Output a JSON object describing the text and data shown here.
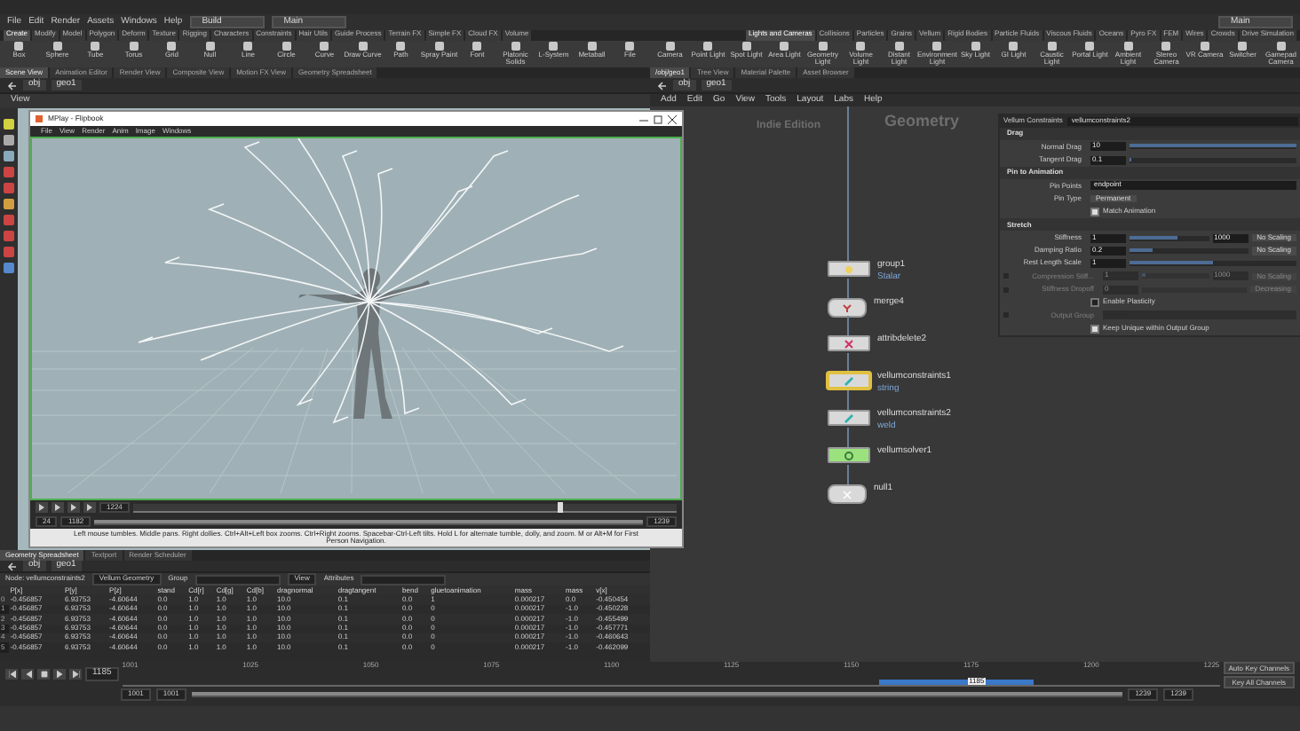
{
  "menu_bar": {
    "items": [
      "File",
      "Edit",
      "Render",
      "Assets",
      "Windows",
      "Help"
    ],
    "build_desktop": "Build",
    "main_desktop": "Main"
  },
  "desktop_menu": "Main",
  "shelf_tabs_left": [
    {
      "label": "Create",
      "selected": true
    },
    {
      "label": "Modify",
      "selected": false
    },
    {
      "label": "Model",
      "selected": false
    },
    {
      "label": "Polygon",
      "selected": false
    },
    {
      "label": "Deform",
      "selected": false
    },
    {
      "label": "Texture",
      "selected": false
    },
    {
      "label": "Rigging",
      "selected": false
    },
    {
      "label": "Characters",
      "selected": false
    },
    {
      "label": "Constraints",
      "selected": false
    },
    {
      "label": "Hair Utils",
      "selected": false
    },
    {
      "label": "Guide Process",
      "selected": false
    },
    {
      "label": "Terrain FX",
      "selected": false
    },
    {
      "label": "Simple FX",
      "selected": false
    },
    {
      "label": "Cloud FX",
      "selected": false
    },
    {
      "label": "Volume",
      "selected": false
    }
  ],
  "shelf_tabs_right": [
    {
      "label": "Lights and Cameras",
      "selected": true
    },
    {
      "label": "Collisions",
      "selected": false
    },
    {
      "label": "Particles",
      "selected": false
    },
    {
      "label": "Grains",
      "selected": false
    },
    {
      "label": "Vellum",
      "selected": false
    },
    {
      "label": "Rigid Bodies",
      "selected": false
    },
    {
      "label": "Particle Fluids",
      "selected": false
    },
    {
      "label": "Viscous Fluids",
      "selected": false
    },
    {
      "label": "Oceans",
      "selected": false
    },
    {
      "label": "Pyro FX",
      "selected": false
    },
    {
      "label": "FEM",
      "selected": false
    },
    {
      "label": "Wires",
      "selected": false
    },
    {
      "label": "Crowds",
      "selected": false
    },
    {
      "label": "Drive Simulation",
      "selected": false
    }
  ],
  "shelf_tools_left": [
    "Box",
    "Sphere",
    "Tube",
    "Torus",
    "Grid",
    "Null",
    "Line",
    "Circle",
    "Curve",
    "Draw Curve",
    "Path",
    "Spray Paint",
    "Font",
    "Platonic Solids",
    "L-System",
    "Metaball",
    "File"
  ],
  "shelf_tools_right": [
    "Camera",
    "Point Light",
    "Spot Light",
    "Area Light",
    "Geometry Light",
    "Volume Light",
    "Distant Light",
    "Environment Light",
    "Sky Light",
    "GI Light",
    "Caustic Light",
    "Portal Light",
    "Ambient Light",
    "Stereo Camera",
    "VR Camera",
    "Switcher",
    "Gamepad Camera"
  ],
  "scene_pane": {
    "tabs": [
      {
        "label": "Scene View",
        "selected": true
      },
      {
        "label": "Animation Editor",
        "selected": false
      },
      {
        "label": "Render View",
        "selected": false
      },
      {
        "label": "Composite View",
        "selected": false
      },
      {
        "label": "Motion FX View",
        "selected": false
      },
      {
        "label": "Geometry Spreadsheet",
        "selected": false
      }
    ],
    "path": [
      "obj",
      "geo1"
    ],
    "view_menu": "View"
  },
  "mplay": {
    "title": "MPlay - Flipbook",
    "menu": [
      "File",
      "View",
      "Render",
      "Anim",
      "Image",
      "Windows"
    ],
    "frame": "1224",
    "step": "24",
    "range_start": "1182",
    "range_end": "1239",
    "playhead": {
      "level": 0.78
    },
    "range": {
      "level": 1
    },
    "status": "Left mouse tumbles. Middle pans. Right dollies. Ctrl+Alt+Left box zooms. Ctrl+Right zooms. Spacebar-Ctrl-Left tilts. Hold L for alternate tumble, dolly, and zoom.    M or Alt+M for First Person Navigation."
  },
  "spreadsheet": {
    "tabs": [
      {
        "label": "Geometry Spreadsheet",
        "selected": true
      },
      {
        "label": "Textport",
        "selected": false
      },
      {
        "label": "Render Scheduler",
        "selected": false
      }
    ],
    "path": [
      "obj",
      "geo1"
    ],
    "node_label": "Node: vellumconstraints2",
    "geometry_menu": "Vellum Geometry",
    "group_label": "Group",
    "view_menu": "View",
    "attributes_label": "Attributes",
    "columns": [
      "",
      "P[x]",
      "P[y]",
      "P[z]",
      "stand",
      "Cd[r]",
      "Cd[g]",
      "Cd[b]",
      "dragnormal",
      "dragtangent",
      "bend",
      "gluetoanimation",
      "mass",
      "mass",
      "v[x]"
    ],
    "rows": [
      [
        "0",
        "-0.456857",
        "6.93753",
        "-4.60644",
        "0.0",
        "1.0",
        "1.0",
        "1.0",
        "10.0",
        "0.1",
        "0.0",
        "1",
        "0.000217",
        "0.0",
        "-0.450454"
      ],
      [
        "1",
        "-0.456857",
        "6.93753",
        "-4.60644",
        "0.0",
        "1.0",
        "1.0",
        "1.0",
        "10.0",
        "0.1",
        "0.0",
        "0",
        "0.000217",
        "-1.0",
        "-0.450228"
      ],
      [
        "2",
        "-0.456857",
        "6.93753",
        "-4.60644",
        "0.0",
        "1.0",
        "1.0",
        "1.0",
        "10.0",
        "0.1",
        "0.0",
        "0",
        "0.000217",
        "-1.0",
        "-0.455499"
      ],
      [
        "3",
        "-0.456857",
        "6.93753",
        "-4.60644",
        "0.0",
        "1.0",
        "1.0",
        "1.0",
        "10.0",
        "0.1",
        "0.0",
        "0",
        "0.000217",
        "-1.0",
        "-0.457771"
      ],
      [
        "4",
        "-0.456857",
        "6.93753",
        "-4.60644",
        "0.0",
        "1.0",
        "1.0",
        "1.0",
        "10.0",
        "0.1",
        "0.0",
        "0",
        "0.000217",
        "-1.0",
        "-0.460643"
      ],
      [
        "5",
        "-0.456857",
        "6.93753",
        "-4.60644",
        "0.0",
        "1.0",
        "1.0",
        "1.0",
        "10.0",
        "0.1",
        "0.0",
        "0",
        "0.000217",
        "-1.0",
        "-0.462099"
      ]
    ]
  },
  "network_pane": {
    "tabs": [
      {
        "label": "/obj/geo1",
        "selected": true
      },
      {
        "label": "Tree View",
        "selected": false
      },
      {
        "label": "Material Palette",
        "selected": false
      },
      {
        "label": "Asset Browser",
        "selected": false
      }
    ],
    "path": [
      "obj",
      "geo1"
    ],
    "menu": [
      "Add",
      "Edit",
      "Go",
      "View",
      "Tools",
      "Layout",
      "Labs",
      "Help"
    ],
    "edition_label": "Indie Edition",
    "context_label": "Geometry",
    "nodes": [
      {
        "name": "group1",
        "kind": "group",
        "comment": "Stalar",
        "highlighted": false,
        "display": false
      },
      {
        "name": "merge4",
        "kind": "merge",
        "highlighted": false,
        "display": false
      },
      {
        "name": "attribdelete2",
        "kind": "attribdelete",
        "highlighted": false,
        "display": false
      },
      {
        "name": "vellumconstraints1",
        "kind": "constraint",
        "comment": "string",
        "highlighted": true,
        "display": false
      },
      {
        "name": "vellumconstraints2",
        "kind": "constraint",
        "comment": "weld",
        "highlighted": false,
        "display": false
      },
      {
        "name": "vellumsolver1",
        "kind": "solver",
        "highlighted": false,
        "display": true
      },
      {
        "name": "null1",
        "kind": "null",
        "highlighted": false,
        "display": false
      }
    ]
  },
  "parameters": {
    "node_type": "Vellum Constraints",
    "node_name": "vellumconstraints2",
    "rows": [
      {
        "kind": "section",
        "label": "Drag"
      },
      {
        "kind": "slider",
        "label": "Normal Drag",
        "value": "10",
        "level": 1
      },
      {
        "kind": "slider",
        "label": "Tangent Drag",
        "value": "0.1",
        "level": 0.01
      },
      {
        "kind": "section",
        "label": "Pin to Animation"
      },
      {
        "kind": "text",
        "label": "Pin Points",
        "value": "endpoint"
      },
      {
        "kind": "menu",
        "label": "Pin Type",
        "value": "Permanent"
      },
      {
        "kind": "checkbox",
        "label": "Match Animation",
        "checked": true
      },
      {
        "kind": "section",
        "label": "Stretch"
      },
      {
        "kind": "stiffness",
        "label": "Stiffness",
        "value": "1",
        "level": 0.6,
        "multiplier": "1000",
        "scaling": "No Scaling",
        "disabled": false
      },
      {
        "kind": "stiffness",
        "label": "Damping Ratio",
        "value": "0.2",
        "level": 0.2,
        "scaling": "No Scaling",
        "disabled": false
      },
      {
        "kind": "slider",
        "label": "Rest Length Scale",
        "value": "1",
        "level": 0.5
      },
      {
        "kind": "stiffness",
        "label": "Compression Stiff...",
        "value": "1",
        "level": 0.05,
        "multiplier": "1000",
        "scaling": "No Scaling",
        "disabled": true
      },
      {
        "kind": "stiffness",
        "label": "Stiffness Dropoff",
        "value": "0",
        "scaling": "Decreasing",
        "disabled": true
      },
      {
        "kind": "checkbox",
        "label": "Enable Plasticity",
        "checked": false
      },
      {
        "kind": "text",
        "label": "Output Group",
        "disabled": true
      },
      {
        "kind": "checkbox",
        "label": "Keep Unique within Output Group",
        "checked": true
      }
    ]
  },
  "timeline": {
    "frame": "1185",
    "ticks": [
      "1001",
      "1025",
      "1050",
      "1075",
      "1100",
      "1125",
      "1150",
      "1175",
      "1200",
      "1225"
    ],
    "playhead": {
      "label": "1185",
      "level": 0.77
    },
    "range": {
      "level": 1
    },
    "buttons": [
      "Auto Key Channels",
      "Key All Channels"
    ],
    "range_start": "1001",
    "range_start_2": "1001",
    "range_end": "1239",
    "range_end_2": "1239"
  }
}
